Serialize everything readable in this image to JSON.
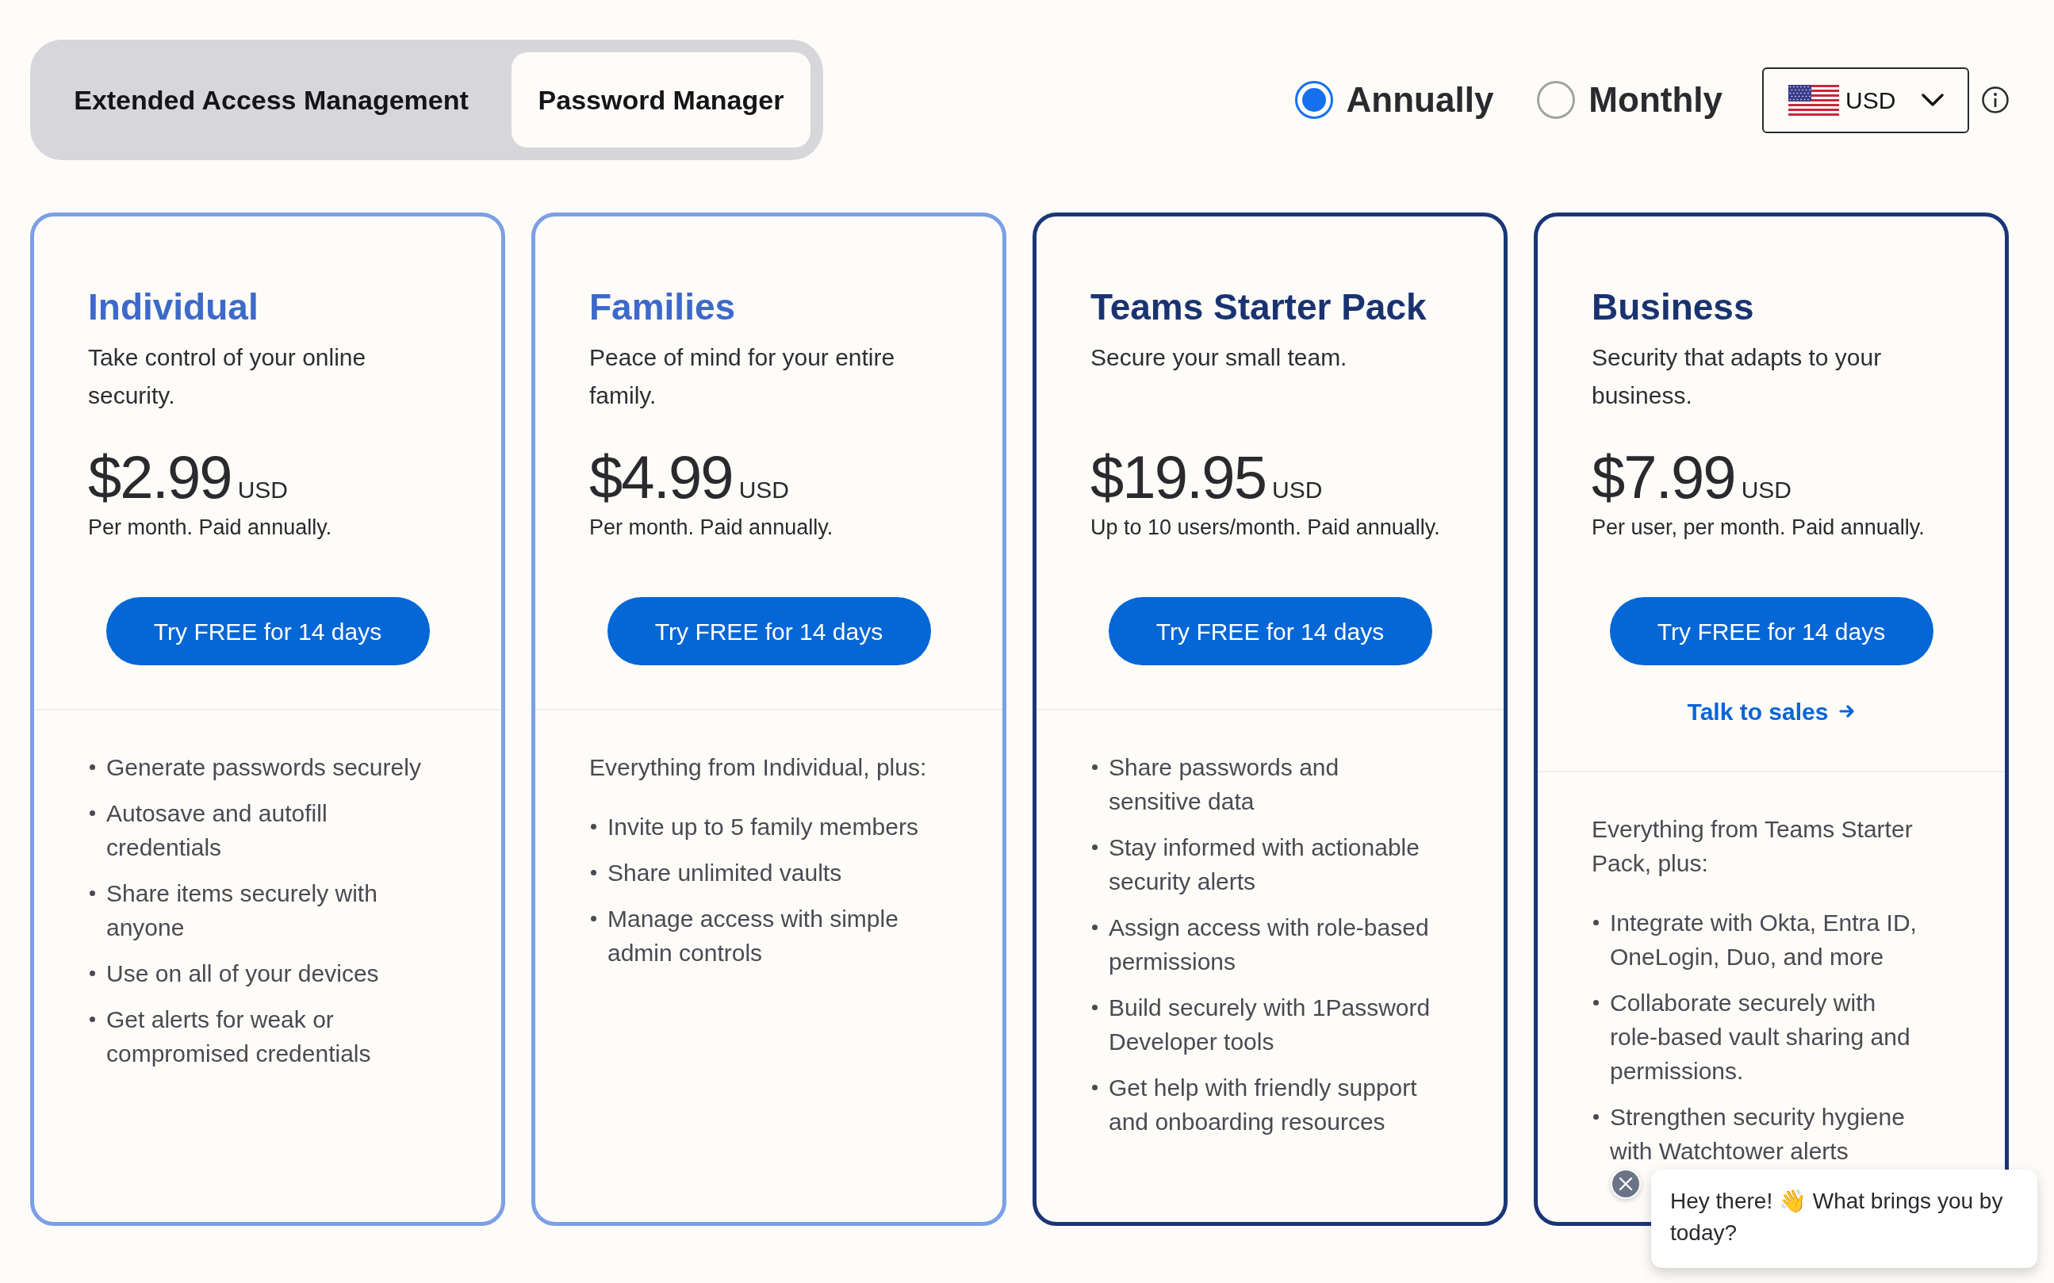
{
  "product_tabs": [
    {
      "label": "Extended Access Management",
      "selected": false
    },
    {
      "label": "Password Manager",
      "selected": true
    }
  ],
  "billing_period": [
    {
      "label": "Annually",
      "selected": true
    },
    {
      "label": "Monthly",
      "selected": false
    }
  ],
  "currency_selector": {
    "value": "USD"
  },
  "plans": [
    {
      "kind": "light",
      "name": "Individual",
      "description": "Take control of your online security.",
      "price": "$2.99",
      "currency": "USD",
      "billing_note": "Per month. Paid annually.",
      "button": "Try FREE for 14 days",
      "features": [
        "Generate passwords securely",
        "Autosave and autofill credentials",
        "Share items securely with anyone",
        "Use on all of your devices",
        "Get alerts for weak or compromised credentials"
      ]
    },
    {
      "kind": "light",
      "name": "Families",
      "description": "Peace of mind for your entire family.",
      "price": "$4.99",
      "currency": "USD",
      "billing_note": "Per month. Paid annually.",
      "button": "Try FREE for 14 days",
      "features_intro": "Everything from Individual, plus:",
      "features": [
        "Invite up to 5 family members",
        "Share unlimited vaults",
        "Manage access with simple admin controls"
      ]
    },
    {
      "kind": "dark",
      "name": "Teams Starter Pack",
      "description": "Secure your small team.",
      "price": "$19.95",
      "currency": "USD",
      "billing_note": "Up to 10 users/month. Paid annually.",
      "button": "Try FREE for 14 days",
      "features": [
        "Share passwords and sensitive data",
        "Stay informed with actionable security alerts",
        "Assign access with role-based permissions",
        "Build securely with 1Password Developer tools",
        "Get help with friendly support and onboarding resources"
      ]
    },
    {
      "kind": "dark",
      "name": "Business",
      "description": "Security that adapts to your business.",
      "price": "$7.99",
      "currency": "USD",
      "billing_note": "Per user, per month. Paid annually.",
      "button": "Try FREE for 14 days",
      "link": "Talk to sales",
      "features_intro": "Everything from Teams Starter Pack, plus:",
      "features": [
        "Integrate with Okta, Entra ID, OneLogin, Duo, and more",
        "Collaborate securely with role-based vault sharing and permissions.",
        "Strengthen security hygiene with Watchtower alerts"
      ]
    }
  ],
  "chat": {
    "message": "Hey there! 👋 What brings you by today?"
  }
}
